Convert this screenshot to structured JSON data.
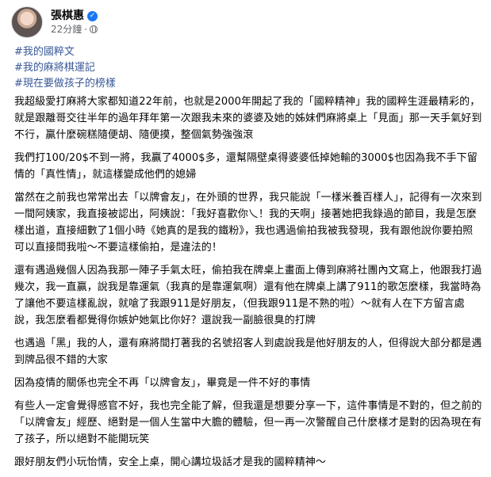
{
  "post": {
    "author": "張棋惠",
    "time": "22分鐘",
    "tags": [
      "#我的國粹文",
      "#我的麻將棋運記",
      "#現在要做孩子的榜樣"
    ],
    "paragraphs": [
      "我超級愛打麻將大家都知道22年前，也就是2000年開起了我的「國粹精神」我的國粹生涯最精彩的，就是跟離哥交往半年的過年拜年第一次跟我未來的婆婆及她的姊妹們麻將桌上「見面」那一天手氣好到不行，贏什麼碗糕隨便胡、隨便摸，整個氣勢強強滾",
      "我們打100/20$不到一將，我贏了4000$多，還幫隔壁桌得婆婆低掉她輸的3000$也因為我不手下留情的「真性情」，就這樣變成他們的媳婦",
      "當然在之前我也常常出去「以牌會友」，在外頭的世界，我只能說「一樣米養百樣人」，記得有一次來到一間阿姨家，我直接被認出，阿姨說：「我好喜歡你乀！我的天啊」接著她把我錄過的節目，我是怎麼樣出道，直接細數了1個小時《她真的是我的鐵粉》，我也遇過偷拍我被我發現，我有跟他說你要拍照可以直接問我啦～不要這樣偷拍，是違法的！",
      "還有遇過幾個人因為我那一陣子手氣太旺，偷拍我在牌桌上畫面上傳到麻將社團內文寫上，他跟我打過幾次，我一直贏，說我是靠運氣（我真的是靠運氣啊）還有他在牌桌上講了911的歌怎麼樣，我當時為了讓他不要這樣亂說，就嗆了我跟911是好朋友，（但我跟911是不熟的啦）～就有人在下方留言處說，我怎麼看都覺得你嫉妒她氣比你好？還說我一副臉很臭的打牌",
      "也遇過「黑」我的人，還有麻將間打著我的名號招客人到處說我是他好朋友的人，但得說大部分都是遇到牌品很不錯的大家",
      "因為疫情的關係也完全不再「以牌會友」，畢竟是一件不好的事情",
      "有些人一定會覺得感官不好，我也完全能了解，但我還是想要分享一下，這件事情是不對的，但之前的「以牌會友」經歷、絕對是一個人生當中大膽的體驗，但一再一次警醒自己什麼樣才是對的因為現在有了孩子，所以絕對不能開玩笑",
      "跟好朋友們小玩怡情，安全上桌，開心講垃圾話才是我的國粹精神～"
    ]
  }
}
